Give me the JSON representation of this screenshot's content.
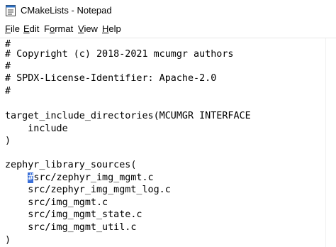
{
  "window": {
    "title": "CMakeLists - Notepad"
  },
  "menu": {
    "file_u": "F",
    "file_rest": "ile",
    "edit_u": "E",
    "edit_rest": "dit",
    "format_pre": "F",
    "format_u": "o",
    "format_rest": "rmat",
    "view_u": "V",
    "view_rest": "iew",
    "help_u": "H",
    "help_rest": "elp"
  },
  "editor": {
    "lines": [
      "#",
      "# Copyright (c) 2018-2021 mcumgr authors",
      "#",
      "# SPDX-License-Identifier: Apache-2.0",
      "#",
      "",
      "target_include_directories(MCUMGR INTERFACE",
      "    include",
      ")",
      "",
      "zephyr_library_sources(",
      "    ",
      "    src/zephyr_img_mgmt_log.c",
      "    src/img_mgmt.c",
      "    src/img_mgmt_state.c",
      "    src/img_mgmt_util.c",
      ")"
    ],
    "selected_char": "#",
    "selected_line_rest": "src/zephyr_img_mgmt.c"
  }
}
